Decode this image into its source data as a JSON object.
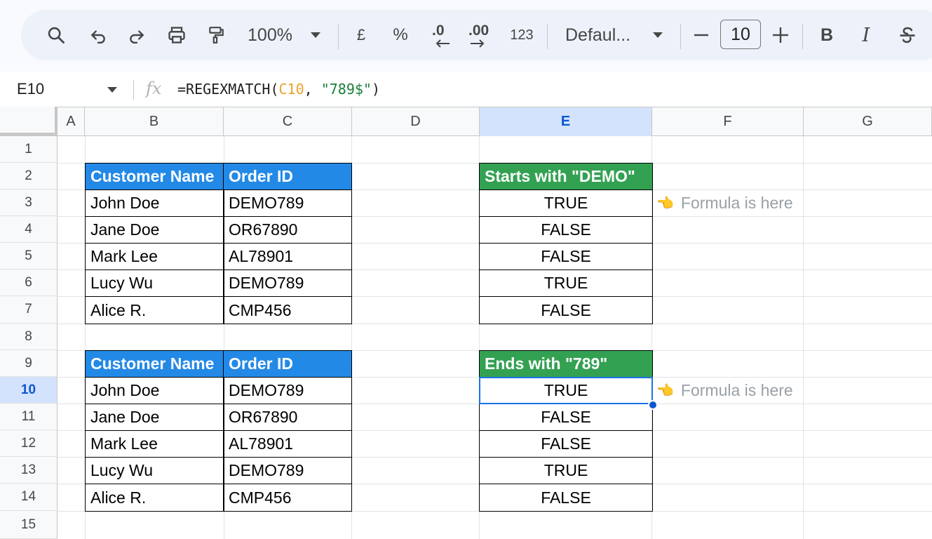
{
  "toolbar": {
    "zoom": "100%",
    "currency": "£",
    "percent": "%",
    "decrease_decimal": ".0",
    "increase_decimal": ".00",
    "format_123": "123",
    "font": "Defaul...",
    "font_size": "10",
    "bold": "B",
    "italic": "I"
  },
  "formula_bar": {
    "cell_ref": "E10",
    "fx": "fx",
    "formula_prefix": "=REGEXMATCH(",
    "formula_ref": "C10",
    "formula_mid": ", ",
    "formula_string": "\"789$\"",
    "formula_suffix": ")"
  },
  "columns": [
    "A",
    "B",
    "C",
    "D",
    "E",
    "F",
    "G"
  ],
  "selected_column": "E",
  "rows": [
    "1",
    "2",
    "3",
    "4",
    "5",
    "6",
    "7",
    "8",
    "9",
    "10",
    "11",
    "12",
    "13",
    "14",
    "15"
  ],
  "selected_row": "10",
  "table1": {
    "header_name": "Customer Name",
    "header_id": "Order ID",
    "rows": [
      {
        "name": "John Doe",
        "id": "DEMO789"
      },
      {
        "name": "Jane Doe",
        "id": "OR67890"
      },
      {
        "name": "Mark Lee",
        "id": "AL78901"
      },
      {
        "name": "Lucy Wu",
        "id": "DEMO789"
      },
      {
        "name": "Alice R.",
        "id": "CMP456"
      }
    ]
  },
  "result1": {
    "header": "Starts with \"DEMO\"",
    "values": [
      "TRUE",
      "FALSE",
      "FALSE",
      "TRUE",
      "FALSE"
    ]
  },
  "table2": {
    "header_name": "Customer Name",
    "header_id": "Order ID",
    "rows": [
      {
        "name": "John Doe",
        "id": "DEMO789"
      },
      {
        "name": "Jane Doe",
        "id": "OR67890"
      },
      {
        "name": "Mark Lee",
        "id": "AL78901"
      },
      {
        "name": "Lucy Wu",
        "id": "DEMO789"
      },
      {
        "name": "Alice R.",
        "id": "CMP456"
      }
    ]
  },
  "result2": {
    "header": "Ends with \"789\"",
    "values": [
      "TRUE",
      "FALSE",
      "FALSE",
      "TRUE",
      "FALSE"
    ]
  },
  "notes": {
    "hand": "👈",
    "note1": "Formula is here",
    "note2": "Formula is here"
  },
  "colors": {
    "header_blue": "#2389e6",
    "header_green": "#33a152",
    "selection": "#1a73e8"
  }
}
